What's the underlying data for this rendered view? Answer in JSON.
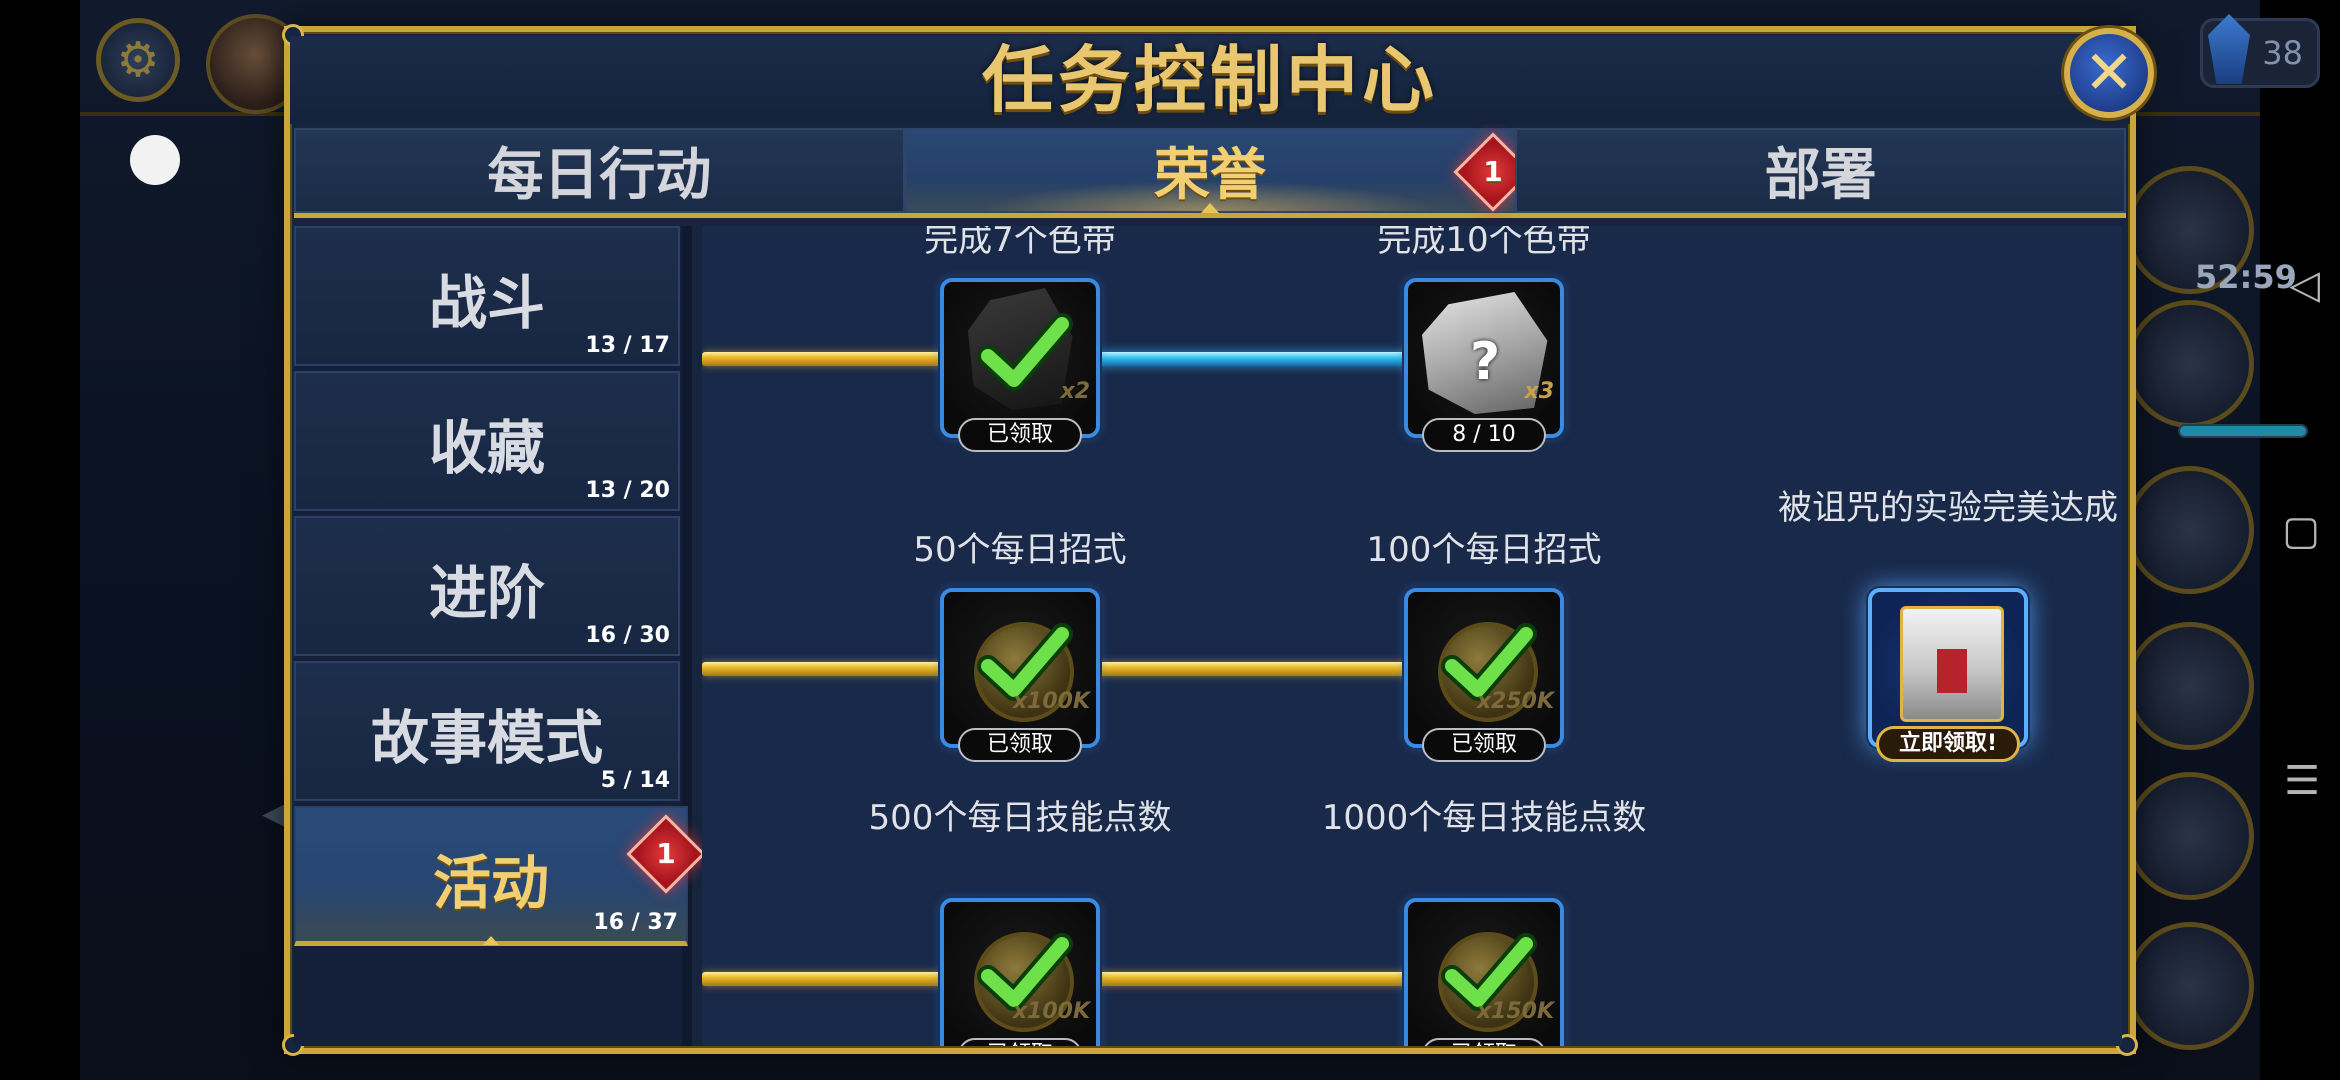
{
  "background": {
    "currency_count": "38",
    "timer": "52:59",
    "badge_count": "1"
  },
  "modal": {
    "title": "任务控制中心",
    "tabs": [
      {
        "label": "每日行动",
        "active": false
      },
      {
        "label": "荣誉",
        "active": true,
        "badge": "1"
      },
      {
        "label": "部署",
        "active": false
      }
    ]
  },
  "categories": [
    {
      "label": "战斗",
      "count": "13 / 17"
    },
    {
      "label": "收藏",
      "count": "13 / 20"
    },
    {
      "label": "进阶",
      "count": "16 / 30"
    },
    {
      "label": "故事模式",
      "count": "5 / 14"
    },
    {
      "label": "活动",
      "count": "16 / 37",
      "active": true,
      "badge": "1"
    }
  ],
  "rows": [
    {
      "nodes": [
        {
          "title": "完成7个色带",
          "status": "已领取",
          "multiplier": "x2"
        },
        {
          "title": "完成10个色带",
          "status": "8 / 10",
          "multiplier": "x3",
          "icon": "mystery-item-icon"
        }
      ]
    },
    {
      "nodes": [
        {
          "title": "50个每日招式",
          "status": "已领取",
          "multiplier": "x100K"
        },
        {
          "title": "100个每日招式",
          "status": "已领取",
          "multiplier": "x250K"
        },
        {
          "title": "被诅咒的实验完美达成",
          "status": "立即领取!",
          "icon": "chest-icon"
        }
      ]
    },
    {
      "nodes": [
        {
          "title": "500个每日技能点数",
          "status": "已领取",
          "multiplier": "x100K"
        },
        {
          "title": "1000个每日技能点数",
          "status": "已领取",
          "multiplier": "x150K"
        }
      ]
    }
  ],
  "colors": {
    "gold": "#c9a53a",
    "panel": "#16243d",
    "track_gold": "#e8b82a",
    "track_blue": "#36c4f2",
    "badge_red": "#a6141d"
  }
}
